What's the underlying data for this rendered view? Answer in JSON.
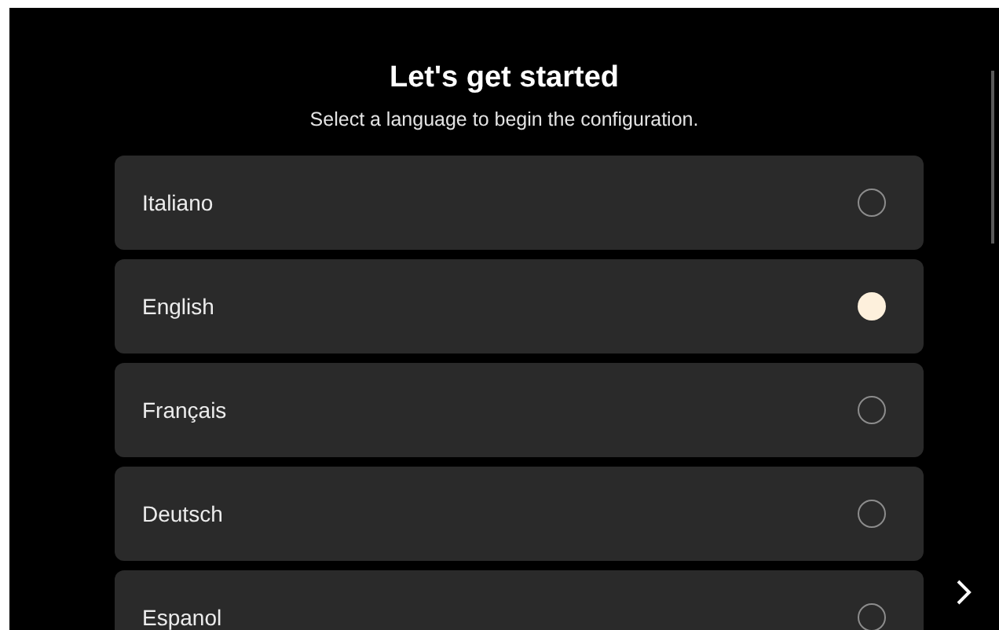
{
  "header": {
    "title": "Let's get started",
    "subtitle": "Select a language to begin the configuration."
  },
  "languages": [
    {
      "label": "Italiano",
      "selected": false
    },
    {
      "label": "English",
      "selected": true
    },
    {
      "label": "Français",
      "selected": false
    },
    {
      "label": "Deutsch",
      "selected": false
    },
    {
      "label": "Espanol",
      "selected": false
    }
  ]
}
